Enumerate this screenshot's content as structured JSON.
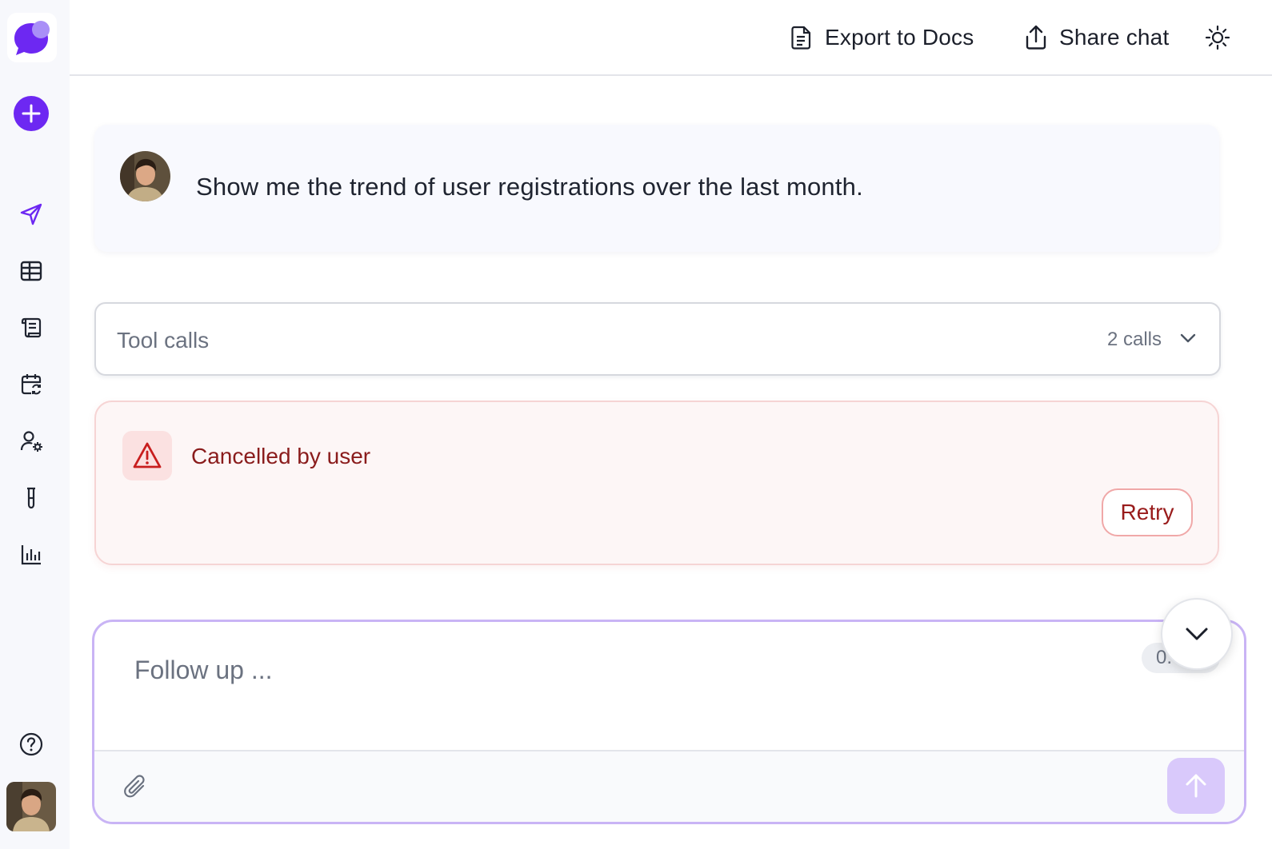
{
  "header": {
    "export_label": "Export to Docs",
    "share_label": "Share chat"
  },
  "sidebar": {
    "items": [
      {
        "icon": "send-icon",
        "name": "chat"
      },
      {
        "icon": "table-icon",
        "name": "tables"
      },
      {
        "icon": "scroll-icon",
        "name": "logs"
      },
      {
        "icon": "calendar-refresh-icon",
        "name": "schedules"
      },
      {
        "icon": "user-settings-icon",
        "name": "users"
      },
      {
        "icon": "test-tube-icon",
        "name": "experiments"
      },
      {
        "icon": "bar-chart-icon",
        "name": "analytics"
      }
    ]
  },
  "conversation": {
    "user_message": "Show me the trend of user registrations over the last month.",
    "tool_calls": {
      "label": "Tool calls",
      "count": "2 calls"
    },
    "error": {
      "message": "Cancelled by user",
      "retry_label": "Retry"
    }
  },
  "composer": {
    "placeholder": "Follow up ...",
    "chip_text": "0."
  },
  "colors": {
    "brand": "#6d28f2",
    "error_text": "#8a1c1c",
    "composer_border": "#c9b4f5"
  }
}
